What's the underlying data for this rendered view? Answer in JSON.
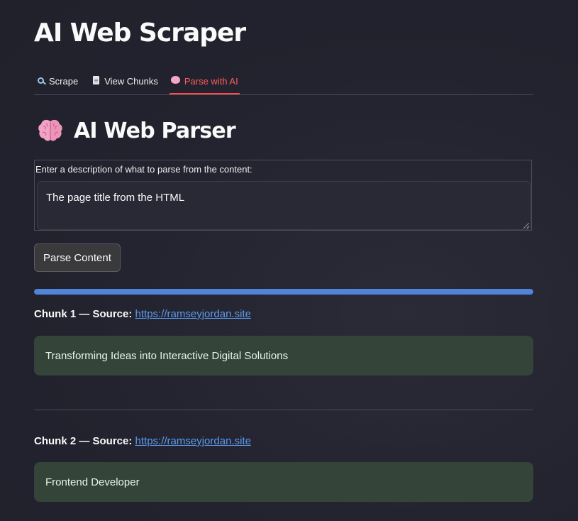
{
  "app": {
    "title": "AI Web Scraper"
  },
  "tabs": [
    {
      "label": "Scrape",
      "icon": "magnifying-glass-icon",
      "active": false
    },
    {
      "label": "View Chunks",
      "icon": "page-icon",
      "active": false
    },
    {
      "label": "Parse with AI",
      "icon": "brain-icon",
      "active": true
    }
  ],
  "section": {
    "icon": "brain-icon",
    "title": "AI Web Parser"
  },
  "parse_input": {
    "label": "Enter a description of what to parse from the content:",
    "value": "The page title from the HTML"
  },
  "parse_button": {
    "label": "Parse Content"
  },
  "progress": {
    "value": 1.0
  },
  "chunks": [
    {
      "heading_prefix": "Chunk 1 — Source:",
      "source_url": "https://ramseyjordan.site",
      "result": "Transforming Ideas into Interactive Digital Solutions"
    },
    {
      "heading_prefix": "Chunk 2 — Source:",
      "source_url": "https://ramseyjordan.site",
      "result": "Frontend Developer"
    }
  ],
  "colors": {
    "background": "#23232f",
    "accent_active_tab": "#ff4b4b",
    "progress_fill": "#4f84d9",
    "link": "#5b9cf0",
    "result_box": "#354439"
  }
}
